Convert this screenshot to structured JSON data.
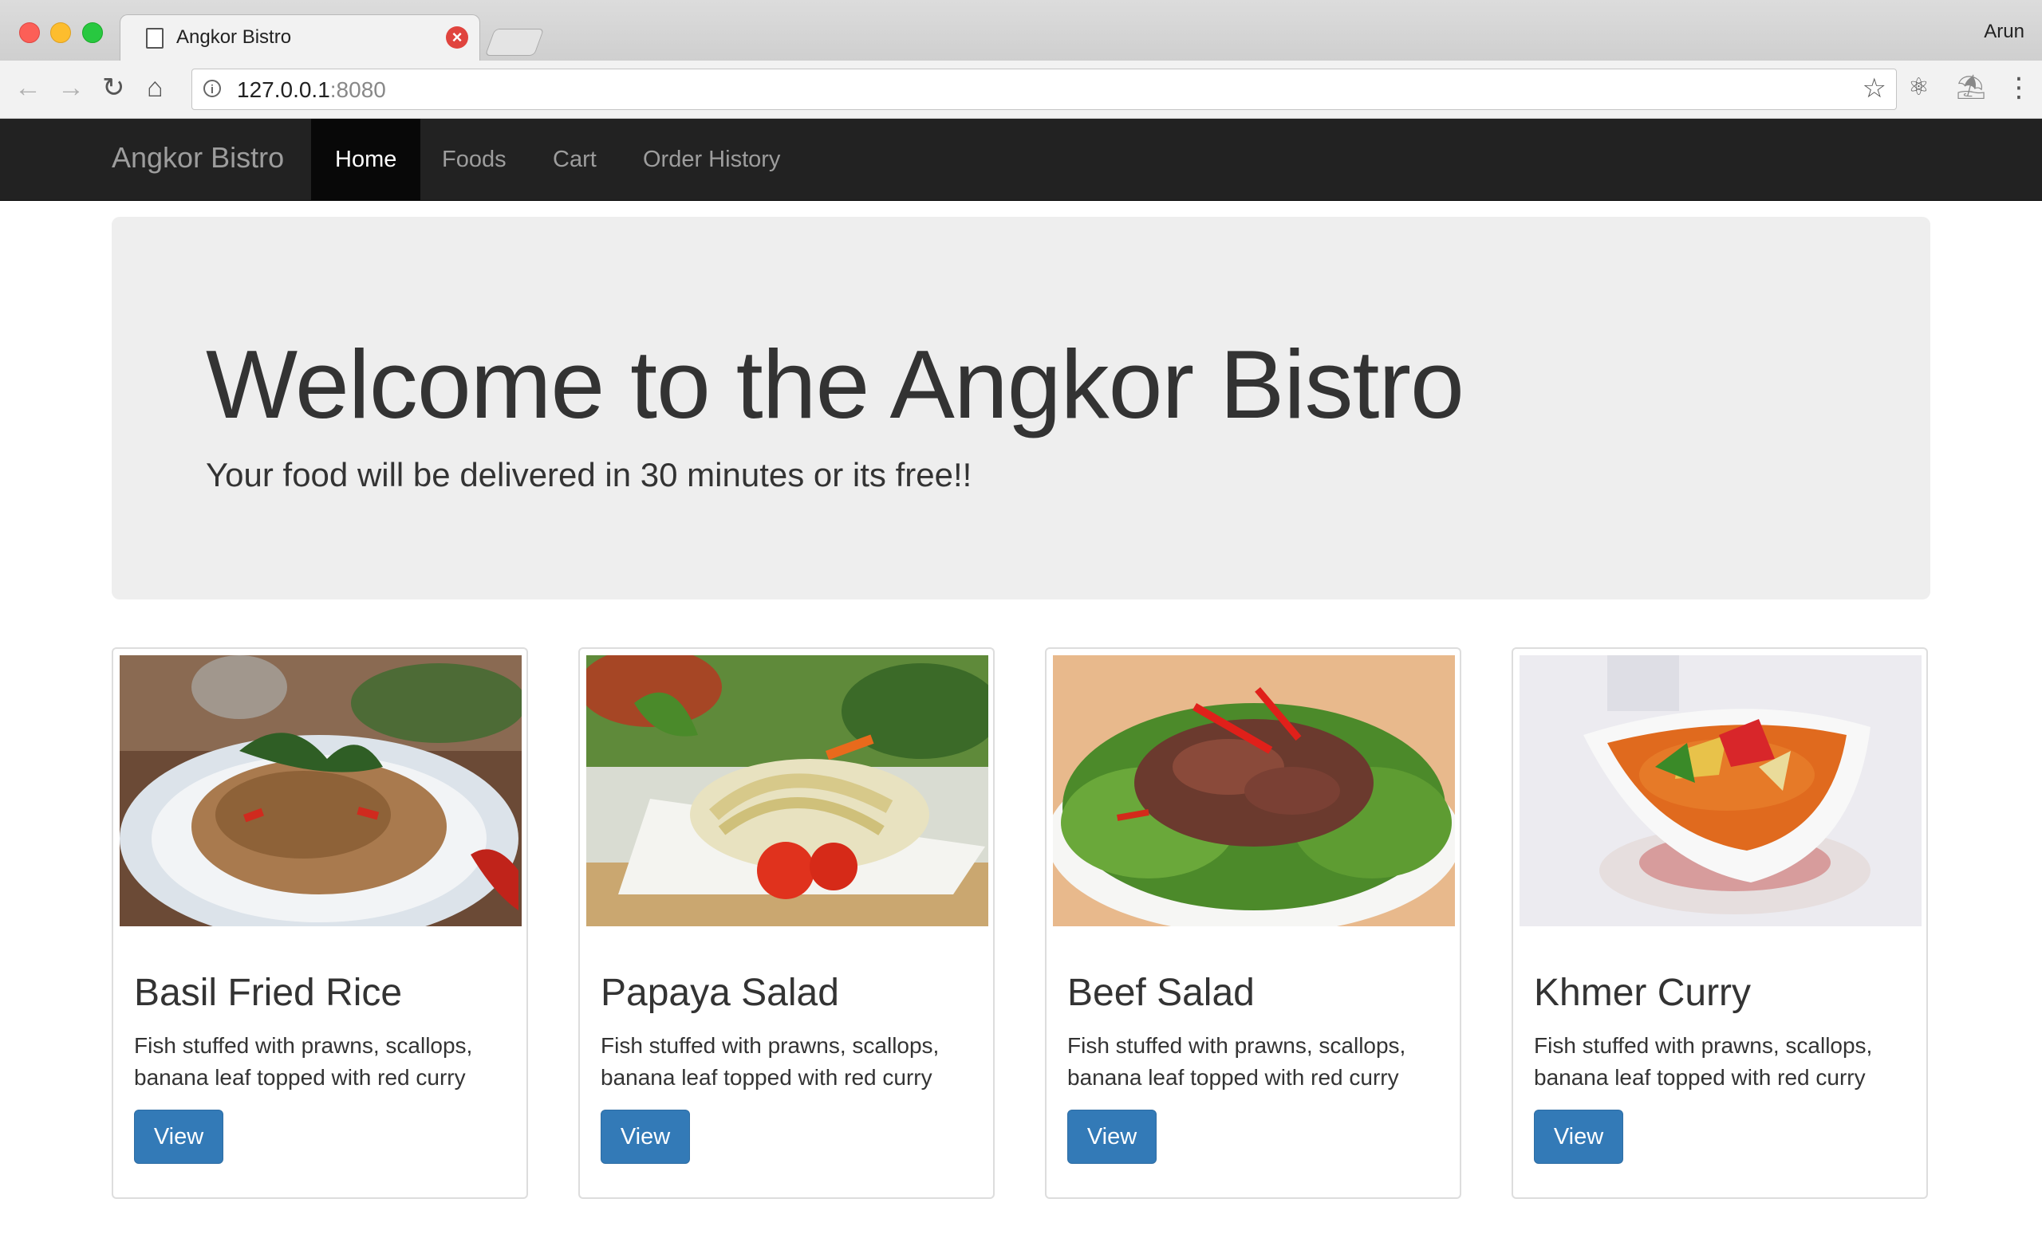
{
  "browser": {
    "tab_title": "Angkor Bistro",
    "profile_name": "Arun",
    "url_host": "127.0.0.1",
    "url_port": ":8080",
    "icons": {
      "back": "back-arrow-icon",
      "forward": "forward-arrow-icon",
      "reload": "reload-icon",
      "home": "home-icon",
      "info": "info-icon",
      "bookmark": "star-icon",
      "extension1": "react-extension-icon",
      "extension2": "palm-extension-icon",
      "menu": "kebab-menu-icon"
    }
  },
  "navbar": {
    "brand": "Angkor Bistro",
    "items": [
      {
        "label": "Home",
        "active": true
      },
      {
        "label": "Foods",
        "active": false
      },
      {
        "label": "Cart",
        "active": false
      },
      {
        "label": "Order History",
        "active": false
      }
    ]
  },
  "jumbotron": {
    "title": "Welcome to the Angkor Bistro",
    "subtitle": "Your food will be delivered in 30 minutes or its free!!"
  },
  "foods": [
    {
      "name": "Basil Fried Rice",
      "description": "Fish stuffed with prawns, scallops, banana leaf topped with red curry",
      "button": "View"
    },
    {
      "name": "Papaya Salad",
      "description": "Fish stuffed with prawns, scallops, banana leaf topped with red curry",
      "button": "View"
    },
    {
      "name": "Beef Salad",
      "description": "Fish stuffed with prawns, scallops, banana leaf topped with red curry",
      "button": "View"
    },
    {
      "name": "Khmer Curry",
      "description": "Fish stuffed with prawns, scallops, banana leaf topped with red curry",
      "button": "View"
    }
  ],
  "colors": {
    "navbar_bg": "#222222",
    "navbar_active": "#080808",
    "jumbotron_bg": "#eeeeee",
    "primary_button": "#337ab7"
  }
}
